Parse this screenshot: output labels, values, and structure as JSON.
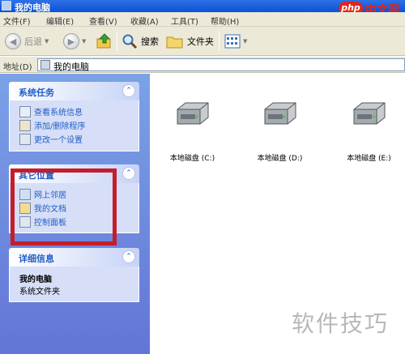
{
  "window": {
    "title": "我的电脑"
  },
  "watermark_logo": {
    "pill": "php",
    "text": "中文网"
  },
  "menu": [
    "文件(F)",
    "编辑(E)",
    "查看(V)",
    "收藏(A)",
    "工具(T)",
    "帮助(H)"
  ],
  "toolbar": {
    "back": "后退",
    "search": "搜索",
    "folders": "文件夹"
  },
  "address": {
    "label": "地址(D)",
    "value": "我的电脑"
  },
  "panels": {
    "system_tasks": {
      "title": "系统任务",
      "items": [
        "查看系统信息",
        "添加/删除程序",
        "更改一个设置"
      ]
    },
    "other_places": {
      "title": "其它位置",
      "items": [
        "网上邻居",
        "我的文档",
        "控制面板"
      ]
    },
    "details": {
      "title": "详细信息",
      "name": "我的电脑",
      "type": "系统文件夹"
    }
  },
  "drives": [
    {
      "label": "本地磁盘 (C:)"
    },
    {
      "label": "本地磁盘 (D:)"
    },
    {
      "label": "本地磁盘 (E:)"
    }
  ],
  "watermark_text": "软件技巧",
  "colors": {
    "highlight_box": "#c51d2b",
    "pane_gradient_top": "#7ba2e7",
    "link": "#215dc6"
  }
}
